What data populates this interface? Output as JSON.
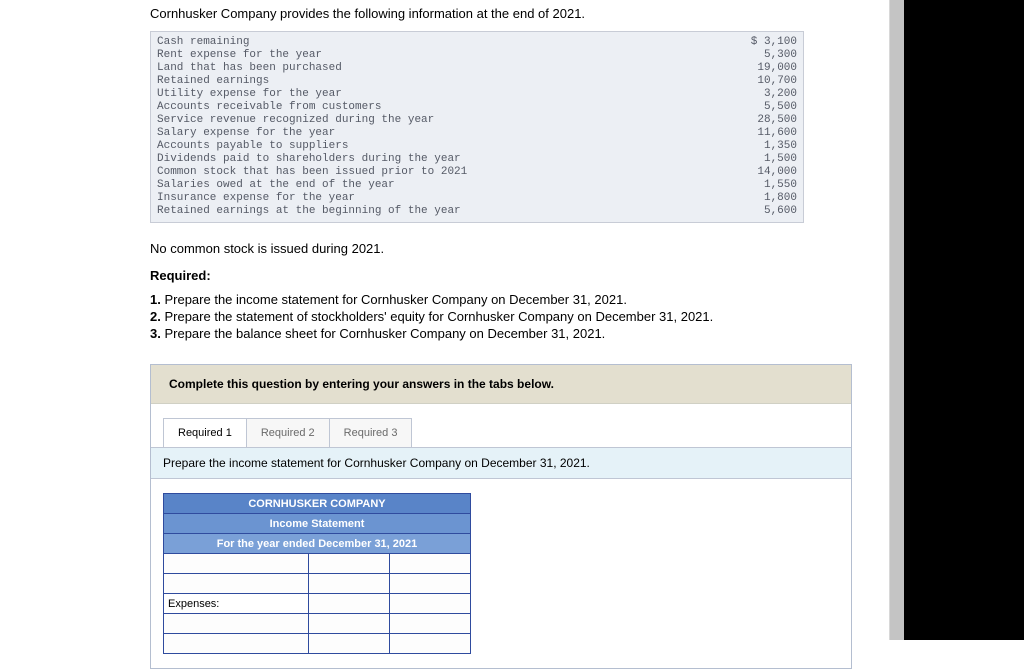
{
  "intro": "Cornhusker Company provides the following information at the end of 2021.",
  "given": {
    "currency_prefix": "$",
    "rows": [
      {
        "label": "Cash remaining",
        "amount": "3,100",
        "prefix": true
      },
      {
        "label": "Rent expense for the year",
        "amount": "5,300"
      },
      {
        "label": "Land that has been purchased",
        "amount": "19,000"
      },
      {
        "label": "Retained earnings",
        "amount": "10,700"
      },
      {
        "label": "Utility expense for the year",
        "amount": "3,200"
      },
      {
        "label": "Accounts receivable from customers",
        "amount": "5,500"
      },
      {
        "label": "Service revenue recognized during the year",
        "amount": "28,500"
      },
      {
        "label": "Salary expense for the year",
        "amount": "11,600"
      },
      {
        "label": "Accounts payable to suppliers",
        "amount": "1,350"
      },
      {
        "label": "Dividends paid to shareholders during the year",
        "amount": "1,500"
      },
      {
        "label": "Common stock that has been issued prior to 2021",
        "amount": "14,000"
      },
      {
        "label": "Salaries owed at the end of the year",
        "amount": "1,550"
      },
      {
        "label": "Insurance expense for the year",
        "amount": "1,800"
      },
      {
        "label": "Retained earnings at the beginning of the year",
        "amount": "5,600"
      }
    ]
  },
  "note": "No common stock is issued during 2021.",
  "required_heading": "Required:",
  "requirements": [
    "Prepare the income statement for Cornhusker Company on December 31, 2021.",
    "Prepare the statement of stockholders' equity for Cornhusker Company on December 31, 2021.",
    "Prepare the balance sheet for Cornhusker Company on December 31, 2021."
  ],
  "panel_instruction": "Complete this question by entering your answers in the tabs below.",
  "tabs": [
    "Required 1",
    "Required 2",
    "Required 3"
  ],
  "prompt": "Prepare the income statement for Cornhusker Company on December 31, 2021.",
  "sheet_headers": {
    "company": "CORNHUSKER COMPANY",
    "title": "Income Statement",
    "period": "For the year ended December 31, 2021"
  },
  "row_labels": {
    "expenses": "Expenses:"
  }
}
